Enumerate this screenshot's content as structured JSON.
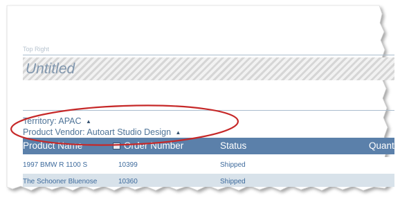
{
  "report": {
    "top_right_label": "Top Right",
    "title": "Untitled",
    "groups": {
      "territory": "Territory: APAC",
      "product_vendor": "Product Vendor: Autoart Studio Design"
    },
    "table": {
      "columns": [
        "Product Name",
        "Order Number",
        "Status",
        "Quant"
      ],
      "rows": [
        {
          "product_name": "1997 BMW R 1100 S",
          "order_number": "10399",
          "status": "Shipped"
        },
        {
          "product_name": "The Schooner Bluenose",
          "order_number": "10360",
          "status": "Shipped"
        }
      ]
    }
  },
  "icons": {
    "sort": "sort-icon",
    "collapse": "triangle-up-icon"
  },
  "colors": {
    "header_bg": "#5b80aa",
    "highlight_oval": "#c62828",
    "text_link": "#4e7397"
  }
}
